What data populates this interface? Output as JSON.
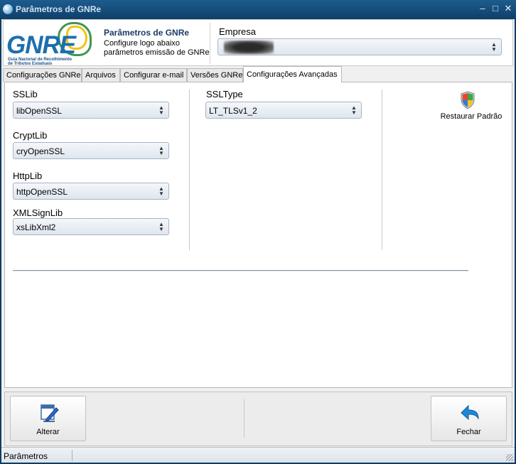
{
  "window": {
    "title": "Parâmetros de GNRe"
  },
  "header": {
    "logo_text": "GNRE",
    "logo_sub_1": "Guia Nacional de Recolhimento",
    "logo_sub_2": "de Tributos Estaduais",
    "title": "Parâmetros de GNRe",
    "desc_line1": "Configure logo abaixo",
    "desc_line2": "parâmetros emissão de GNRe",
    "empresa_label": "Empresa",
    "empresa_value": ""
  },
  "tabs": [
    {
      "label": "Configurações GNRe"
    },
    {
      "label": "Arquivos"
    },
    {
      "label": "Configurar e-mail"
    },
    {
      "label": "Versões GNRe"
    },
    {
      "label": "Configurações Avançadas"
    }
  ],
  "active_tab": "Configurações Avançadas",
  "form": {
    "ssllib": {
      "label": "SSLib",
      "value": "libOpenSSL"
    },
    "cryptlib": {
      "label": "CryptLib",
      "value": "cryOpenSSL"
    },
    "httplib": {
      "label": "HttpLib",
      "value": "httpOpenSSL"
    },
    "xmlsignlib": {
      "label": "XMLSignLib",
      "value": "xsLibXml2"
    },
    "ssltype": {
      "label": "SSLType",
      "value": "LT_TLSv1_2"
    },
    "restore_label": "Restaurar Padrão"
  },
  "toolbar": {
    "alterar_label": "Alterar",
    "fechar_label": "Fechar"
  },
  "status": {
    "text": "Parâmetros"
  },
  "colors": {
    "titlebar": "#0e3f69",
    "accent": "#1d6fae",
    "arrow_blue": "#1e88d6"
  }
}
